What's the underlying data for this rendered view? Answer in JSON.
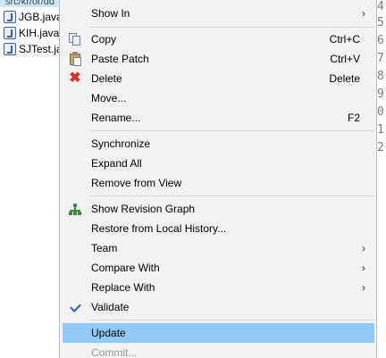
{
  "tree": {
    "path": "src/kr/or/dd",
    "files": [
      "JGB.java",
      "KIH.java",
      "SJTest.java"
    ]
  },
  "editor": {
    "line_numbers": [
      "4",
      "5",
      "6",
      "7",
      "8",
      "9",
      "0",
      "1",
      "2"
    ]
  },
  "menu": {
    "highlight_color": "#91c9f7",
    "items": {
      "show_in": {
        "label": "Show In",
        "submenu": true
      },
      "copy": {
        "label": "Copy",
        "shortcut": "Ctrl+C",
        "icon": "copy-icon"
      },
      "paste_patch": {
        "label": "Paste Patch",
        "shortcut": "Ctrl+V",
        "icon": "paste-icon"
      },
      "delete": {
        "label": "Delete",
        "shortcut": "Delete",
        "icon": "delete-icon"
      },
      "move": {
        "label": "Move..."
      },
      "rename": {
        "label": "Rename...",
        "shortcut": "F2"
      },
      "synchronize": {
        "label": "Synchronize"
      },
      "expand_all": {
        "label": "Expand All"
      },
      "remove_from_view": {
        "label": "Remove from View"
      },
      "show_revision_graph": {
        "label": "Show Revision Graph",
        "icon": "revision-graph-icon"
      },
      "restore_history": {
        "label": "Restore from Local History..."
      },
      "team": {
        "label": "Team",
        "submenu": true
      },
      "compare_with": {
        "label": "Compare With",
        "submenu": true
      },
      "replace_with": {
        "label": "Replace With",
        "submenu": true
      },
      "validate": {
        "label": "Validate",
        "checked": true,
        "icon": "check-icon"
      },
      "update": {
        "label": "Update",
        "highlighted": true
      },
      "commit": {
        "label": "Commit...",
        "disabled": true
      }
    }
  }
}
